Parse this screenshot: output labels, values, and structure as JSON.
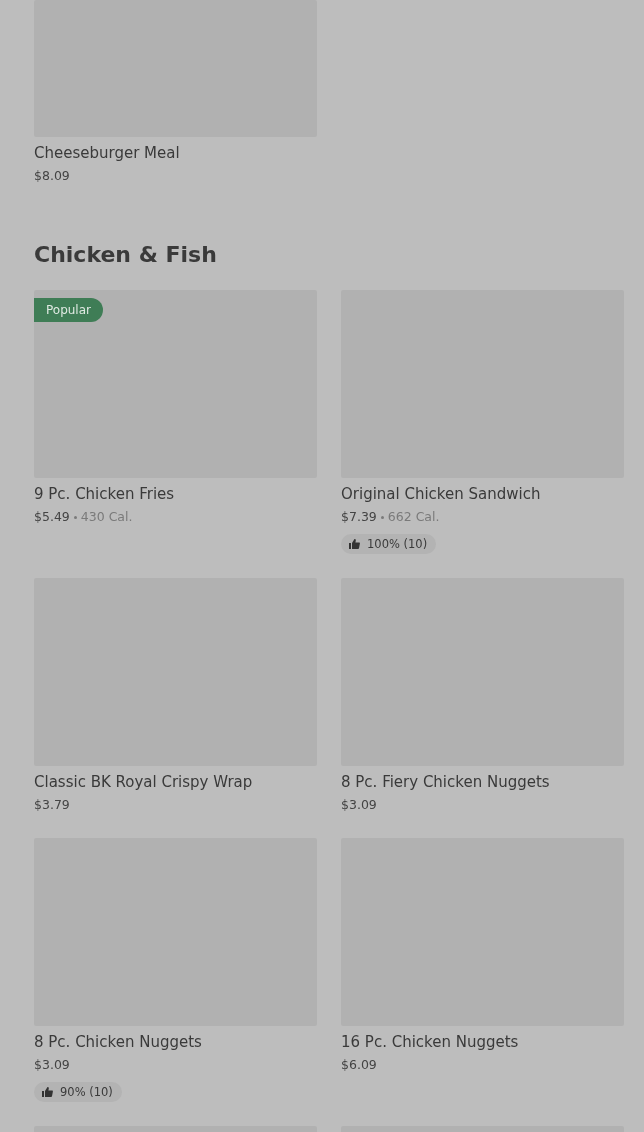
{
  "sections": [
    {
      "items": [
        {
          "kind": "full",
          "name": "Cheeseburger Meal",
          "price": "$8.09"
        }
      ]
    },
    {
      "heading": "Chicken & Fish",
      "items": [
        {
          "kind": "full",
          "badge": "Popular",
          "name": "9 Pc. Chicken Fries",
          "price": "$5.49",
          "calories": "430 Cal."
        },
        {
          "kind": "full",
          "name": "Original Chicken Sandwich",
          "price": "$7.39",
          "calories": "662 Cal.",
          "rating": "100% (10)"
        },
        {
          "kind": "full",
          "name": "Classic BK Royal Crispy Wrap",
          "price": "$3.79"
        },
        {
          "kind": "full",
          "name": "8 Pc. Fiery Chicken Nuggets",
          "price": "$3.09"
        },
        {
          "kind": "full",
          "name": "8 Pc. Chicken Nuggets",
          "price": "$3.09",
          "rating": "90% (10)"
        },
        {
          "kind": "full",
          "name": "16 Pc. Chicken Nuggets",
          "price": "$6.09"
        },
        {
          "kind": "cut"
        },
        {
          "kind": "cut"
        }
      ]
    }
  ]
}
